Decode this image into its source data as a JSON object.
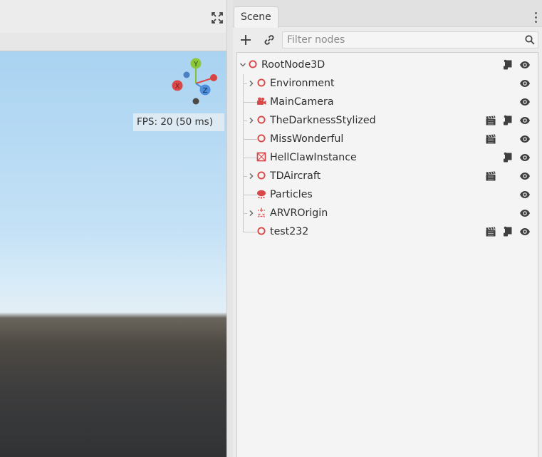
{
  "viewport": {
    "fps_text": "FPS: 20 (50 ms)",
    "gizmo": {
      "x_label": "X",
      "y_label": "Y",
      "z_label": "Z"
    },
    "fullscreen_icon": "expand-arrows-icon"
  },
  "dock": {
    "tab_label": "Scene",
    "filter_placeholder": "Filter nodes",
    "filter_value": ""
  },
  "colors": {
    "node_icon": "#d94848",
    "gizmo_x": "#e04a4a",
    "gizmo_y": "#86c233",
    "gizmo_z": "#4a8bd8",
    "sky_top": "#a9d3f1",
    "ground": "#3c3c3d"
  },
  "tree": [
    {
      "label": "RootNode3D",
      "depth": 0,
      "expandable": true,
      "icon": "node3d-circle-icon",
      "has_scene": false,
      "has_script": true,
      "visible": true
    },
    {
      "label": "Environment",
      "depth": 1,
      "expandable": true,
      "icon": "node3d-circle-icon",
      "has_scene": false,
      "has_script": false,
      "visible": true
    },
    {
      "label": "MainCamera",
      "depth": 1,
      "expandable": false,
      "icon": "camera-icon",
      "has_scene": false,
      "has_script": false,
      "visible": true
    },
    {
      "label": "TheDarknessStylized",
      "depth": 1,
      "expandable": true,
      "icon": "node3d-circle-icon",
      "has_scene": true,
      "has_script": true,
      "visible": true
    },
    {
      "label": "MissWonderful",
      "depth": 1,
      "expandable": false,
      "icon": "node3d-circle-icon",
      "has_scene": true,
      "has_script": false,
      "visible": true
    },
    {
      "label": "HellClawInstance",
      "depth": 1,
      "expandable": false,
      "icon": "mesh-instance-icon",
      "has_scene": false,
      "has_script": true,
      "visible": true
    },
    {
      "label": "TDAircraft",
      "depth": 1,
      "expandable": true,
      "icon": "node3d-circle-icon",
      "has_scene": true,
      "has_script": false,
      "visible": true
    },
    {
      "label": "Particles",
      "depth": 1,
      "expandable": false,
      "icon": "particles-icon",
      "has_scene": false,
      "has_script": false,
      "visible": true
    },
    {
      "label": "ARVROrigin",
      "depth": 1,
      "expandable": true,
      "icon": "arvr-origin-icon",
      "has_scene": false,
      "has_script": false,
      "visible": true
    },
    {
      "label": "test232",
      "depth": 1,
      "expandable": false,
      "icon": "node3d-circle-icon",
      "has_scene": true,
      "has_script": true,
      "visible": true
    }
  ]
}
